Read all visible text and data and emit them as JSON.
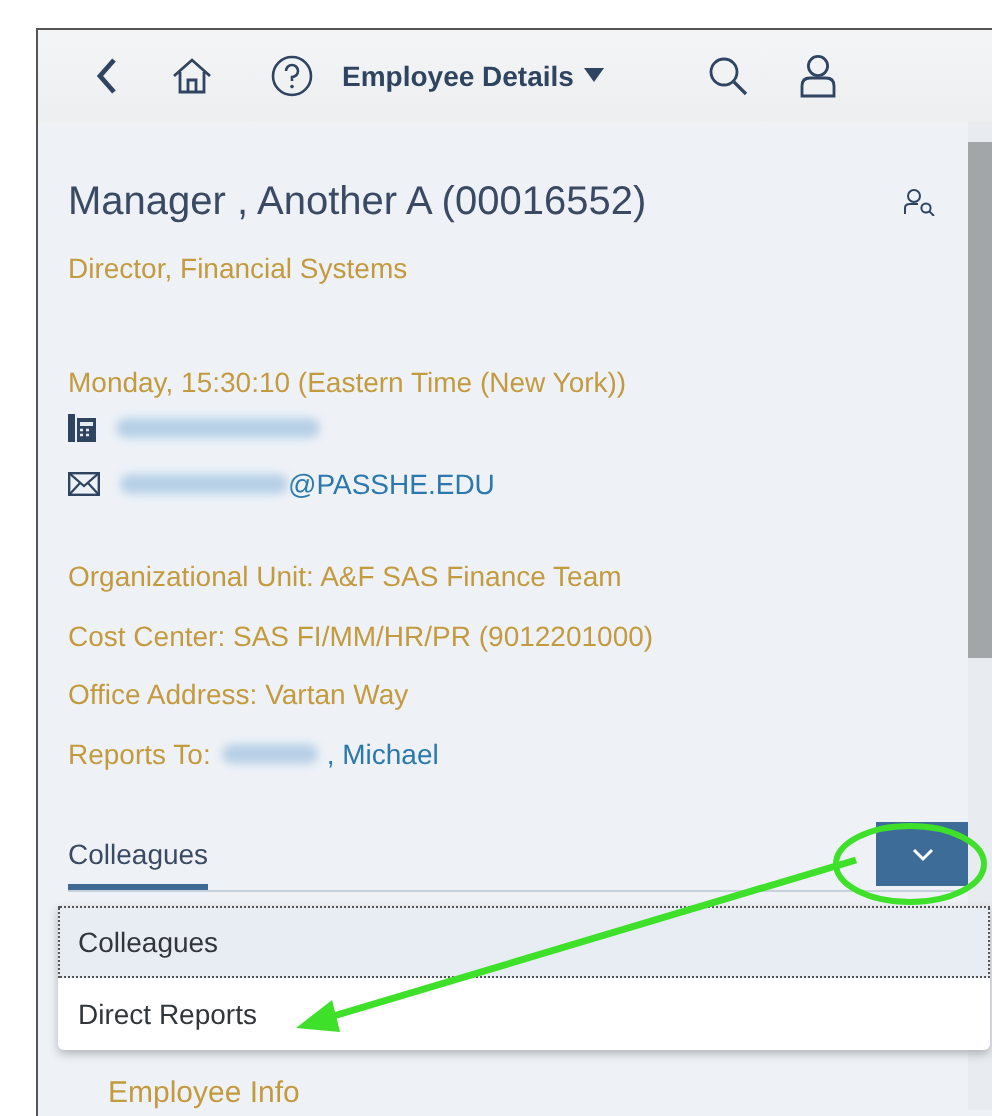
{
  "header": {
    "title": "Employee Details"
  },
  "employee": {
    "name": "Manager , Another A (00016552)",
    "job_title": "Director, Financial Systems",
    "local_time": "Monday, 15:30:10 (Eastern Time (New York))",
    "email_domain": "@PASSHE.EDU",
    "details": [
      "Organizational Unit: A&F SAS Finance Team",
      "Cost Center: SAS FI/MM/HR/PR (9012201000)",
      "Office Address: Vartan Way"
    ],
    "reports_to": {
      "label": "Reports To:",
      "name": ", Michael"
    }
  },
  "tabs": [
    {
      "label": "Colleagues",
      "selected": true
    }
  ],
  "dropdown": {
    "items": [
      {
        "label": "Colleagues",
        "selected": true
      },
      {
        "label": "Direct Reports",
        "selected": false
      }
    ]
  },
  "next_section": {
    "title": "Employee Info"
  }
}
